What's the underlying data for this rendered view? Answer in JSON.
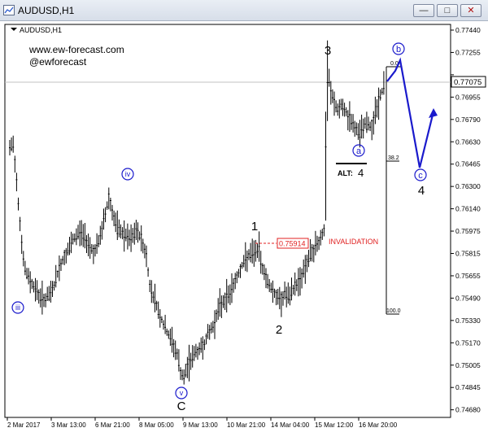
{
  "window": {
    "title": "AUDUSD,H1",
    "buttons": {
      "minimize": "—",
      "maximize": "□",
      "close": "✕"
    }
  },
  "chart": {
    "symbol_label": "AUDUSD,H1",
    "watermark": [
      "www.ew-forecast.com",
      "@ewforecast"
    ],
    "current_price": "0.77075",
    "price_ticks": [
      "0.77440",
      "0.77255",
      "0.77075",
      "0.76955",
      "0.76790",
      "0.76630",
      "0.76465",
      "0.76300",
      "0.76140",
      "0.75975",
      "0.75815",
      "0.75655",
      "0.75490",
      "0.75330",
      "0.75170",
      "0.75005",
      "0.74845",
      "0.74680"
    ],
    "time_ticks": [
      "2 Mar 2017",
      "3 Mar 13:00",
      "6 Mar 21:00",
      "8 Mar 05:00",
      "9 Mar 13:00",
      "10 Mar 21:00",
      "14 Mar 04:00",
      "15 Mar 12:00",
      "16 Mar 20:00"
    ],
    "waves": {
      "iii": "iii",
      "iv": "iv",
      "v": "v",
      "C": "C",
      "w1": "1",
      "w2": "2",
      "w3": "3",
      "a": "a",
      "b": "b",
      "c": "c",
      "w4": "4",
      "alt": "ALT:",
      "alt_num": "4"
    },
    "invalidation": {
      "level": "0.75914",
      "label": "INVALIDATION"
    },
    "fib": {
      "top": "0.0",
      "mid": "38.2",
      "bottom": "100.0"
    }
  },
  "colors": {
    "wave_blue": "#1a1acc",
    "invalidation_red": "#e02020",
    "candle": "#000000",
    "text": "#000000"
  }
}
